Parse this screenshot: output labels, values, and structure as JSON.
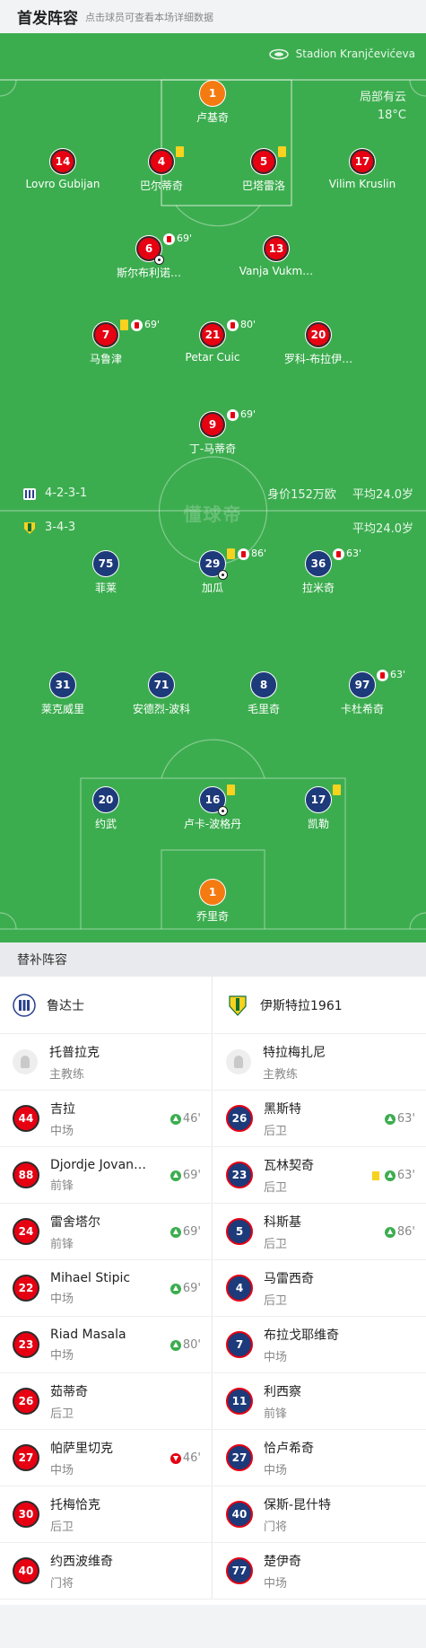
{
  "header": {
    "title": "首发阵容",
    "hint": "点击球员可查看本场详细数据"
  },
  "venue": {
    "stadium": "Stadion Kranjčevićeva",
    "weather": "局部有云",
    "temperature": "18°C"
  },
  "watermark": "懂球帝",
  "home": {
    "formation": "4-2-3-1",
    "value": "身价152万欧",
    "avg_age": "平均24.0岁",
    "players": [
      {
        "number": "1",
        "name": "卢基奇",
        "color": "orange"
      },
      {
        "number": "14",
        "name": "Lovro Gubijan",
        "color": "red"
      },
      {
        "number": "4",
        "name": "巴尔蒂奇",
        "color": "red",
        "yellow": true
      },
      {
        "number": "5",
        "name": "巴塔雷洛",
        "color": "red",
        "yellow": true
      },
      {
        "number": "17",
        "name": "Vilim Kruslin",
        "color": "red"
      },
      {
        "number": "6",
        "name": "斯尔布利诺…",
        "color": "red",
        "sub_out": "69'",
        "goal": true
      },
      {
        "number": "13",
        "name": "Vanja Vukm…",
        "color": "red"
      },
      {
        "number": "7",
        "name": "马鲁津",
        "color": "red",
        "yellow": true,
        "sub_out": "69'"
      },
      {
        "number": "21",
        "name": "Petar Cuic",
        "color": "red",
        "sub_out": "80'"
      },
      {
        "number": "20",
        "name": "罗科-布拉伊…",
        "color": "red"
      },
      {
        "number": "9",
        "name": "丁-马蒂奇",
        "color": "red",
        "sub_out": "69'"
      }
    ]
  },
  "away": {
    "formation": "3-4-3",
    "avg_age": "平均24.0岁",
    "players": [
      {
        "number": "75",
        "name": "菲莱",
        "color": "navy"
      },
      {
        "number": "29",
        "name": "加瓜",
        "color": "navy",
        "yellow": true,
        "sub_out": "86'",
        "goal": true
      },
      {
        "number": "36",
        "name": "拉米奇",
        "color": "navy",
        "sub_out": "63'"
      },
      {
        "number": "31",
        "name": "莱克威里",
        "color": "navy"
      },
      {
        "number": "71",
        "name": "安德烈-波科",
        "color": "navy"
      },
      {
        "number": "8",
        "name": "毛里奇",
        "color": "navy"
      },
      {
        "number": "97",
        "name": "卡杜希奇",
        "color": "navy",
        "sub_out": "63'"
      },
      {
        "number": "20",
        "name": "约武",
        "color": "navy"
      },
      {
        "number": "16",
        "name": "卢卡-波格丹",
        "color": "navy",
        "yellow": true,
        "goal": true
      },
      {
        "number": "17",
        "name": "凯勒",
        "color": "navy",
        "yellow": true
      },
      {
        "number": "1",
        "name": "乔里奇",
        "color": "orange"
      }
    ]
  },
  "substitutes": {
    "title": "替补阵容",
    "home": {
      "team_name": "鲁达士",
      "coach": {
        "name": "托普拉克",
        "role": "主教练"
      },
      "list": [
        {
          "number": "44",
          "name": "吉拉",
          "position": "中场",
          "event": "46'",
          "event_type": "in"
        },
        {
          "number": "88",
          "name": "Djordje Jovan…",
          "position": "前锋",
          "event": "69'",
          "event_type": "in"
        },
        {
          "number": "24",
          "name": "雷舍塔尔",
          "position": "前锋",
          "event": "69'",
          "event_type": "in"
        },
        {
          "number": "22",
          "name": "Mihael Stipic",
          "position": "中场",
          "event": "69'",
          "event_type": "in"
        },
        {
          "number": "23",
          "name": "Riad Masala",
          "position": "中场",
          "event": "80'",
          "event_type": "in"
        },
        {
          "number": "26",
          "name": "茹蒂奇",
          "position": "后卫",
          "event": "",
          "event_type": ""
        },
        {
          "number": "27",
          "name": "帕萨里切克",
          "position": "中场",
          "event": "46'",
          "event_type": "out"
        },
        {
          "number": "30",
          "name": "托梅恰克",
          "position": "后卫",
          "event": "",
          "event_type": ""
        },
        {
          "number": "40",
          "name": "约西波维奇",
          "position": "门将",
          "event": "",
          "event_type": ""
        }
      ]
    },
    "away": {
      "team_name": "伊斯特拉1961",
      "coach": {
        "name": "特拉梅扎尼",
        "role": "主教练"
      },
      "list": [
        {
          "number": "26",
          "name": "黑斯特",
          "position": "后卫",
          "event": "63'",
          "event_type": "in"
        },
        {
          "number": "23",
          "name": "瓦林契奇",
          "position": "后卫",
          "event": "63'",
          "event_type": "in",
          "yellow": true
        },
        {
          "number": "5",
          "name": "科斯基",
          "position": "后卫",
          "event": "86'",
          "event_type": "in"
        },
        {
          "number": "4",
          "name": "马雷西奇",
          "position": "后卫",
          "event": "",
          "event_type": ""
        },
        {
          "number": "7",
          "name": "布拉戈耶维奇",
          "position": "中场",
          "event": "",
          "event_type": ""
        },
        {
          "number": "11",
          "name": "利西察",
          "position": "前锋",
          "event": "",
          "event_type": ""
        },
        {
          "number": "27",
          "name": "恰卢希奇",
          "position": "中场",
          "event": "",
          "event_type": ""
        },
        {
          "number": "40",
          "name": "保斯-昆什特",
          "position": "门将",
          "event": "",
          "event_type": ""
        },
        {
          "number": "77",
          "name": "楚伊奇",
          "position": "中场",
          "event": "",
          "event_type": ""
        }
      ]
    }
  }
}
